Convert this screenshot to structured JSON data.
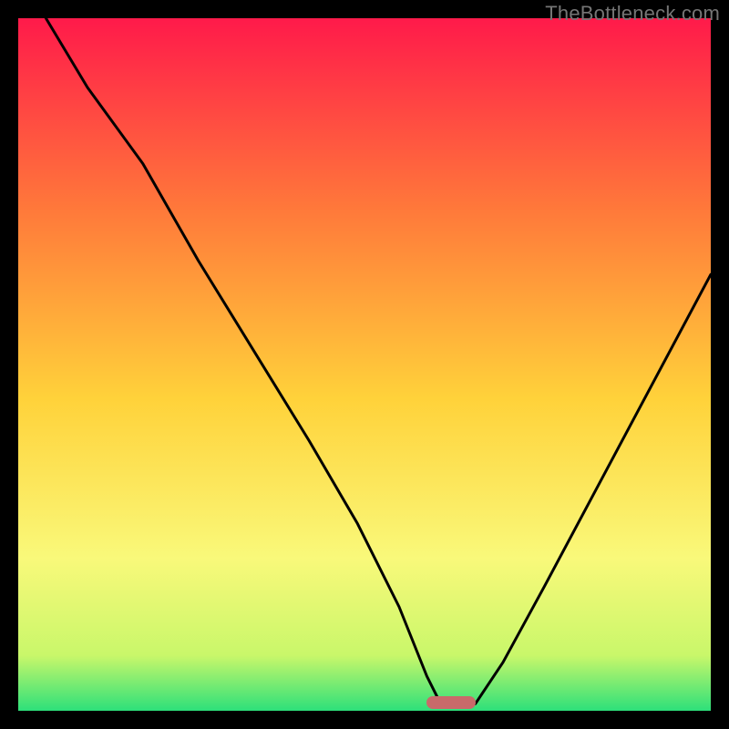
{
  "watermark": "TheBottleneck.com",
  "colors": {
    "top": "#ff1a4a",
    "mid_upper": "#ff7a3a",
    "mid": "#ffd23a",
    "mid_lower": "#f9f97a",
    "near_bottom": "#c9f76a",
    "bottom": "#2de07a",
    "curve": "#000000",
    "marker": "#c96a6a",
    "frame": "#000000"
  },
  "chart_data": {
    "type": "line",
    "title": "",
    "xlabel": "",
    "ylabel": "",
    "xlim": [
      0,
      100
    ],
    "ylim": [
      0,
      100
    ],
    "marker": {
      "x_start": 59,
      "x_end": 66,
      "y": 1.2
    },
    "series": [
      {
        "name": "bottleneck-curve",
        "x": [
          4,
          10,
          18,
          26,
          34,
          42,
          49,
          55,
          59,
          61,
          63,
          66,
          70,
          76,
          84,
          92,
          100
        ],
        "values": [
          100,
          90,
          79,
          65,
          52,
          39,
          27,
          15,
          5,
          1,
          0.5,
          1,
          7,
          18,
          33,
          48,
          63
        ]
      }
    ]
  }
}
